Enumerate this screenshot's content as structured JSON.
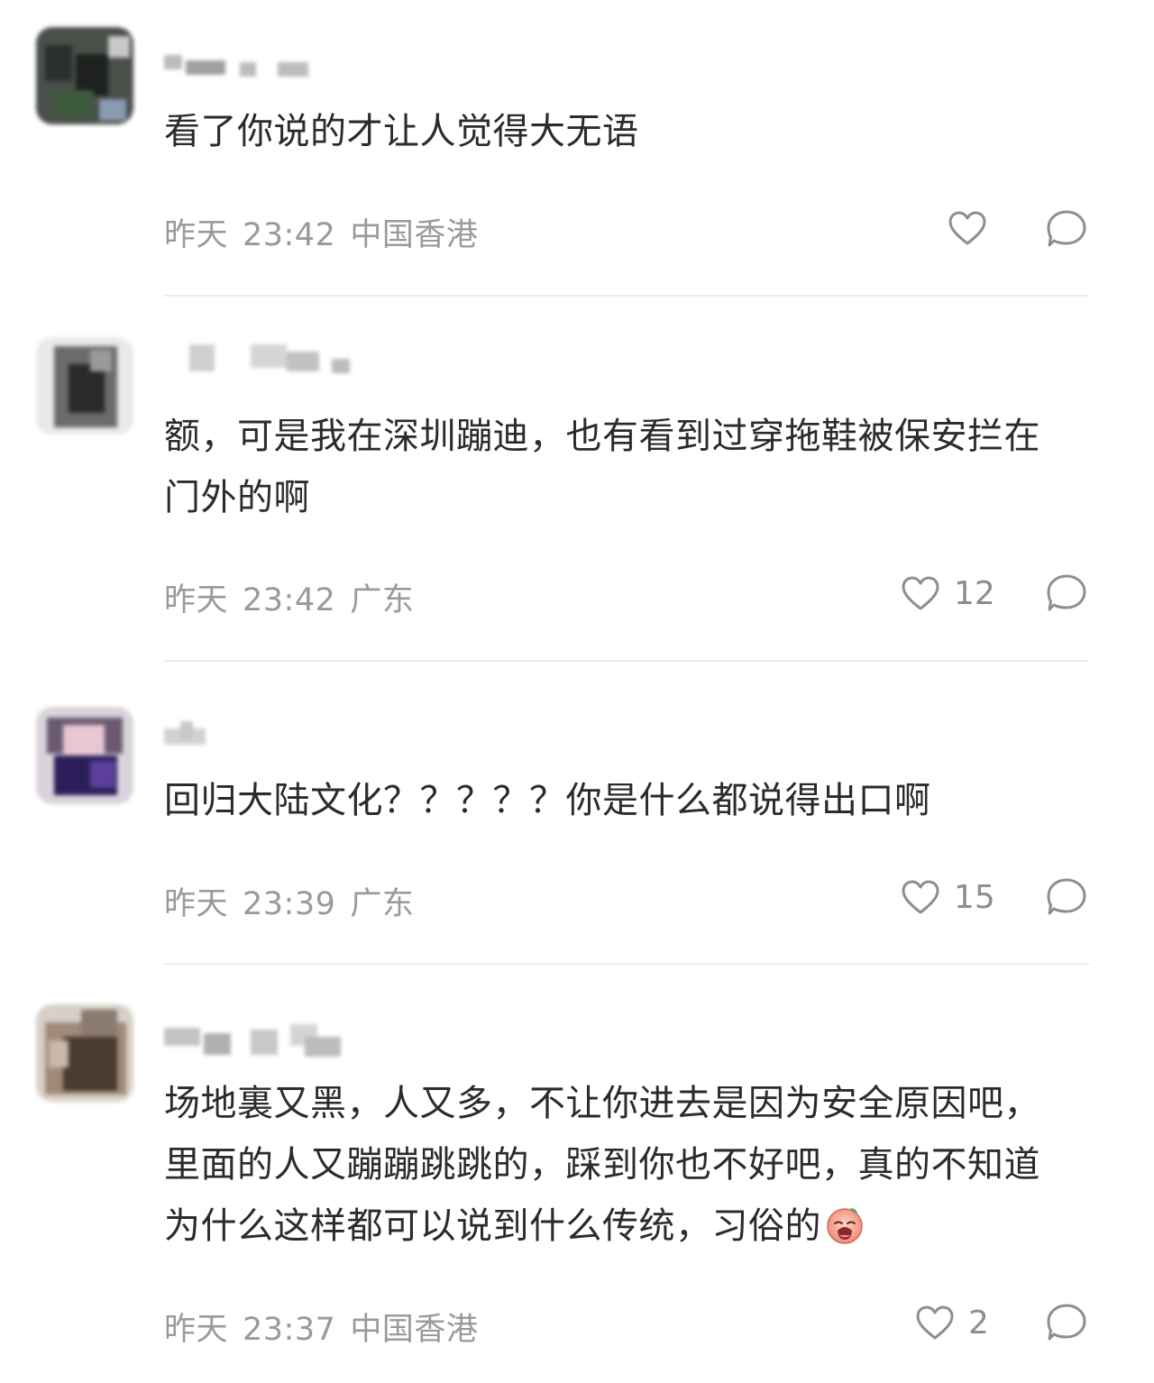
{
  "comments": [
    {
      "text": "看了你说的才让人觉得大无语",
      "date": "昨天",
      "time": "23:42",
      "location": "中国香港",
      "likes": ""
    },
    {
      "text": "额，可是我在深圳蹦迪，也有看到过穿拖鞋被保安拦在门外的啊",
      "date": "昨天",
      "time": "23:42",
      "location": "广东",
      "likes": "12"
    },
    {
      "text": "回归大陆文化？？？？？你是什么都说得出口啊",
      "date": "昨天",
      "time": "23:39",
      "location": "广东",
      "likes": "15"
    },
    {
      "text": "场地裏又黑，人又多，不让你进去是因为安全原因吧，里面的人又蹦蹦跳跳的，踩到你也不好吧，真的不知道为什么这样都可以说到什么传统，习俗的",
      "date": "昨天",
      "time": "23:37",
      "location": "中国香港",
      "likes": "2",
      "emoji": "crying-face-emoji"
    }
  ],
  "colors": {
    "text": "#2b2b2b",
    "meta": "#9a9a9a",
    "icon": "#8e8e8e",
    "divider": "#ececec"
  }
}
